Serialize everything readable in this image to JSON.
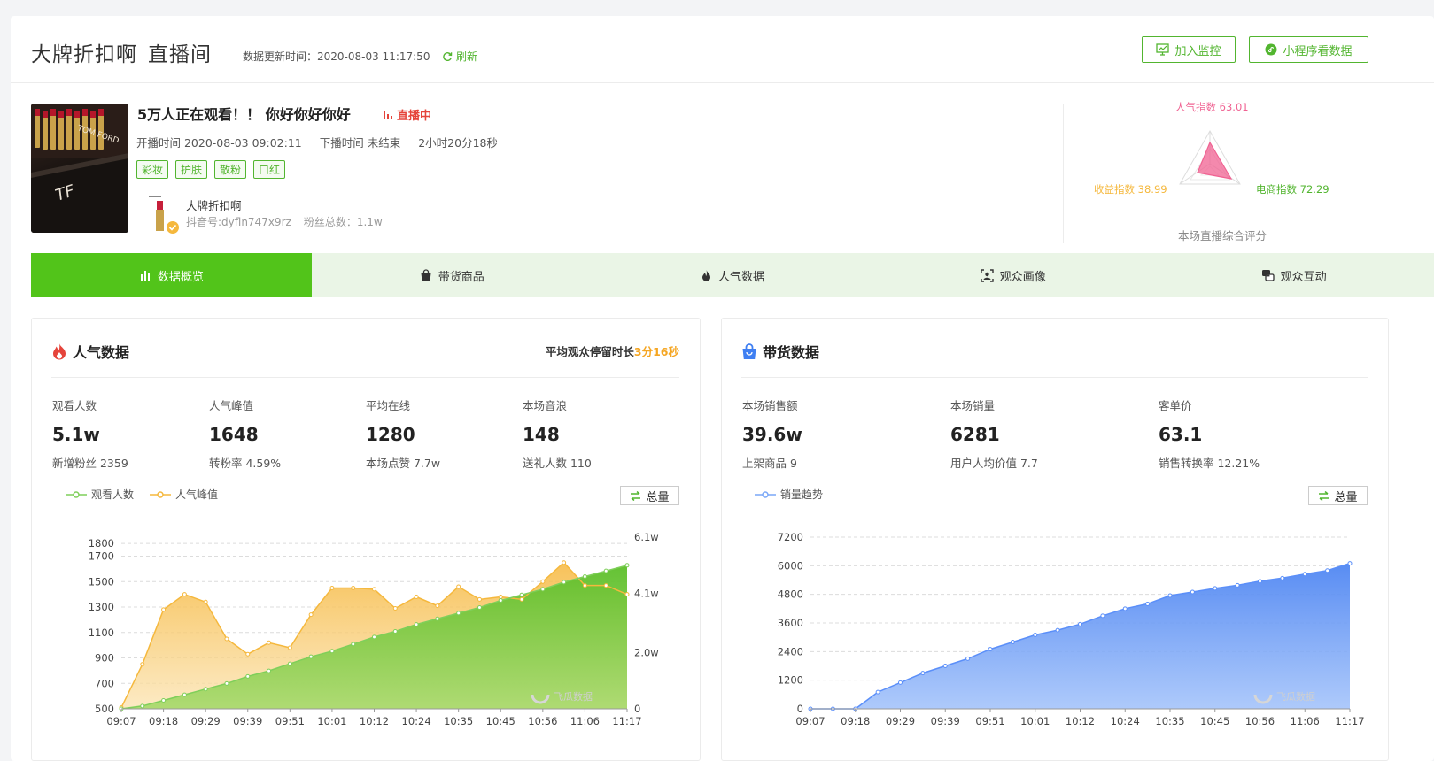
{
  "header": {
    "title_main": "大牌折扣啊",
    "title_sub": "直播间",
    "update_label": "数据更新时间：2020-08-03 11:17:50",
    "refresh_label": "刷新",
    "btn_monitor": "加入监控",
    "btn_mini": "小程序看数据",
    "accent": "#52b52f"
  },
  "live": {
    "title": "5万人正在观看！！ 你好你好你好",
    "status": "直播中",
    "start": "开播时间 2020-08-03 09:02:11",
    "end": "下播时间 未结束",
    "duration": "2小时20分18秒",
    "tags": [
      "彩妆",
      "护肤",
      "散粉",
      "口红"
    ],
    "anchor_name": "大牌折扣啊",
    "douyin_id": "抖音号:dyfln747x9rz",
    "fans": "粉丝总数：1.1w",
    "cover_brand": "TOM FORD",
    "cover_logo": "TF"
  },
  "radar": {
    "popularity": "人气指数 63.01",
    "revenue": "收益指数 38.99",
    "ecommerce": "电商指数 72.29",
    "caption": "本场直播综合评分",
    "values": [
      63.01,
      72.29,
      38.99
    ]
  },
  "tabs": [
    {
      "label": "数据概览",
      "icon": "bar-chart-icon",
      "active": true
    },
    {
      "label": "带货商品",
      "icon": "bag-icon",
      "active": false
    },
    {
      "label": "人气数据",
      "icon": "flame-icon",
      "active": false
    },
    {
      "label": "观众画像",
      "icon": "portrait-icon",
      "active": false
    },
    {
      "label": "观众互动",
      "icon": "chat-icon",
      "active": false
    }
  ],
  "popularity": {
    "title": "人气数据",
    "avg_stay_label": "平均观众停留时长",
    "avg_stay_value": "3分16秒",
    "stats": [
      {
        "label": "观看人数",
        "value": "5.1w",
        "sub": "新增粉丝 2359"
      },
      {
        "label": "人气峰值",
        "value": "1648",
        "sub": "转粉率 4.59%"
      },
      {
        "label": "平均在线",
        "value": "1280",
        "sub": "本场点赞 7.7w"
      },
      {
        "label": "本场音浪",
        "value": "148",
        "sub": "送礼人数 110"
      }
    ],
    "legend_viewers": "观看人数",
    "legend_peak": "人气峰值",
    "total_label": "总量"
  },
  "sales": {
    "title": "带货数据",
    "stats": [
      {
        "label": "本场销售额",
        "value": "39.6w",
        "sub": "上架商品 9"
      },
      {
        "label": "本场销量",
        "value": "6281",
        "sub": "用户人均价值 7.7"
      },
      {
        "label": "客单价",
        "value": "63.1",
        "sub": "销售转换率 12.21%"
      }
    ],
    "legend_trend": "销量趋势",
    "total_label": "总量"
  },
  "watermark": "飞瓜数据",
  "chart_data": [
    {
      "type": "area",
      "categories": [
        "09:07",
        "09:18",
        "09:29",
        "09:39",
        "09:51",
        "10:01",
        "10:12",
        "10:24",
        "10:35",
        "10:45",
        "10:56",
        "11:06",
        "11:17"
      ],
      "left_axis_ticks": [
        "1800",
        "1700",
        "1500",
        "1300",
        "1100",
        "900",
        "700",
        "500"
      ],
      "right_axis_ticks": [
        "6.1w",
        "4.1w",
        "2.0w",
        "0"
      ],
      "series": [
        {
          "name": "人气峰值",
          "axis": "left",
          "color": "#f5b83d",
          "values": [
            510,
            850,
            1280,
            1400,
            1340,
            1050,
            930,
            1020,
            980,
            1240,
            1450,
            1450,
            1440,
            1290,
            1380,
            1310,
            1460,
            1360,
            1380,
            1360,
            1500,
            1650,
            1470,
            1470,
            1400
          ]
        },
        {
          "name": "观看人数",
          "axis": "right",
          "color": "#52c41a",
          "values": [
            0,
            1000,
            3000,
            5000,
            7000,
            9000,
            11500,
            13500,
            16000,
            18500,
            20500,
            23000,
            25500,
            27500,
            30000,
            32000,
            34000,
            36000,
            38500,
            40500,
            42500,
            45000,
            47000,
            49000,
            51000
          ]
        }
      ],
      "left_ylim": [
        500,
        1850
      ],
      "right_ylim": [
        0,
        61000
      ]
    },
    {
      "type": "area",
      "categories": [
        "09:07",
        "09:18",
        "09:29",
        "09:39",
        "09:51",
        "10:01",
        "10:12",
        "10:24",
        "10:35",
        "10:45",
        "10:56",
        "11:06",
        "11:17"
      ],
      "yticks": [
        "7200",
        "6000",
        "4800",
        "3600",
        "2400",
        "1200",
        "0"
      ],
      "series": [
        {
          "name": "销量趋势",
          "color": "#5b8ff9",
          "values": [
            0,
            0,
            0,
            700,
            1100,
            1500,
            1800,
            2100,
            2500,
            2800,
            3100,
            3300,
            3550,
            3900,
            4200,
            4400,
            4750,
            4900,
            5050,
            5180,
            5350,
            5480,
            5650,
            5800,
            6100
          ]
        }
      ],
      "ylim": [
        0,
        7200
      ]
    }
  ]
}
